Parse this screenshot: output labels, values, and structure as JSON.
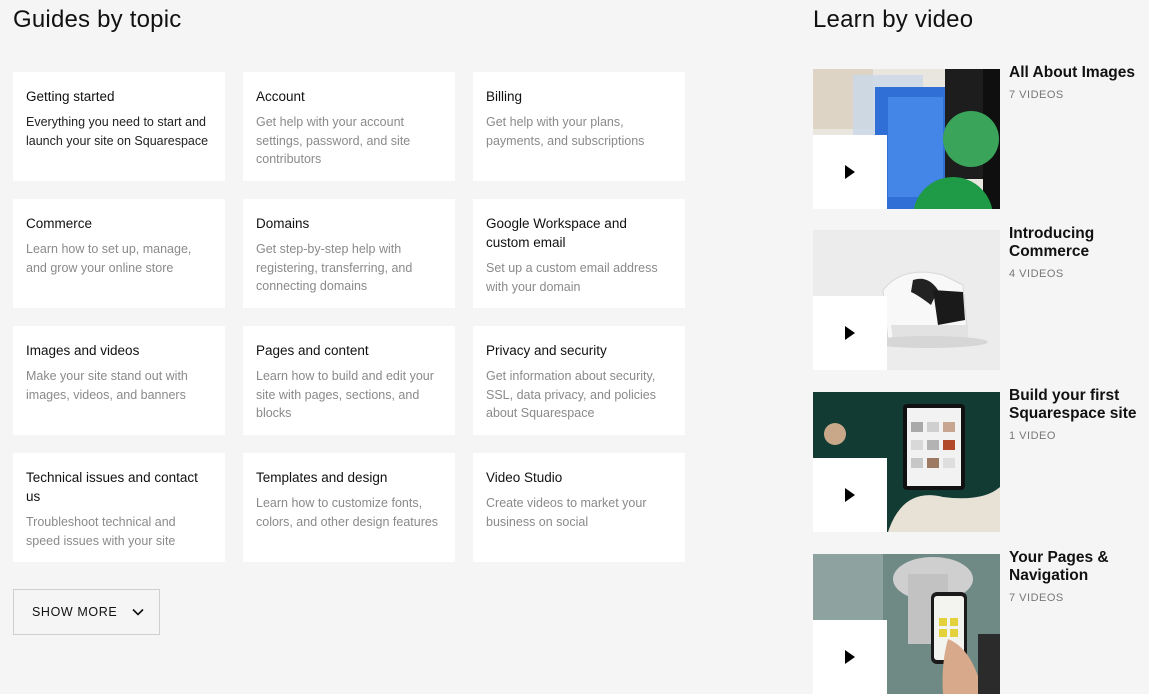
{
  "guides": {
    "title": "Guides by topic",
    "cards": [
      {
        "title": "Getting started",
        "desc": "Everything you need to start and launch your site on Squarespace"
      },
      {
        "title": "Account",
        "desc": "Get help with your account settings, password, and site contributors"
      },
      {
        "title": "Billing",
        "desc": "Get help with your plans, payments, and subscriptions"
      },
      {
        "title": "Commerce",
        "desc": "Learn how to set up, manage, and grow your online store"
      },
      {
        "title": "Domains",
        "desc": "Get step-by-step help with registering, transferring, and connecting domains"
      },
      {
        "title": "Google Workspace and custom email",
        "desc": "Set up a custom email address with your domain"
      },
      {
        "title": "Images and videos",
        "desc": "Make your site stand out with images, videos, and banners"
      },
      {
        "title": "Pages and content",
        "desc": "Learn how to build and edit your site with pages, sections, and blocks"
      },
      {
        "title": "Privacy and security",
        "desc": "Get information about security, SSL, data privacy, and policies about Squarespace"
      },
      {
        "title": "Technical issues and contact us",
        "desc": "Troubleshoot technical and speed issues with your site"
      },
      {
        "title": "Templates and design",
        "desc": "Learn how to customize fonts, colors, and other design features"
      },
      {
        "title": "Video Studio",
        "desc": "Create videos to market your business on social"
      }
    ],
    "show_more_label": "SHOW MORE",
    "show_more_icon": "chevron-down-icon"
  },
  "videos": {
    "title": "Learn by video",
    "play_icon": "play-icon",
    "items": [
      {
        "title": "All About Images",
        "count": "7 VIDEOS"
      },
      {
        "title": "Introducing Commerce",
        "count": "4 VIDEOS"
      },
      {
        "title": "Build your first Squarespace site",
        "count": "1 VIDEO"
      },
      {
        "title": "Your Pages & Navigation",
        "count": "7 VIDEOS"
      }
    ]
  },
  "colors": {
    "background": "#f5f5f5",
    "card": "#ffffff",
    "text": "#111111",
    "muted_text": "#8a8a8a"
  }
}
